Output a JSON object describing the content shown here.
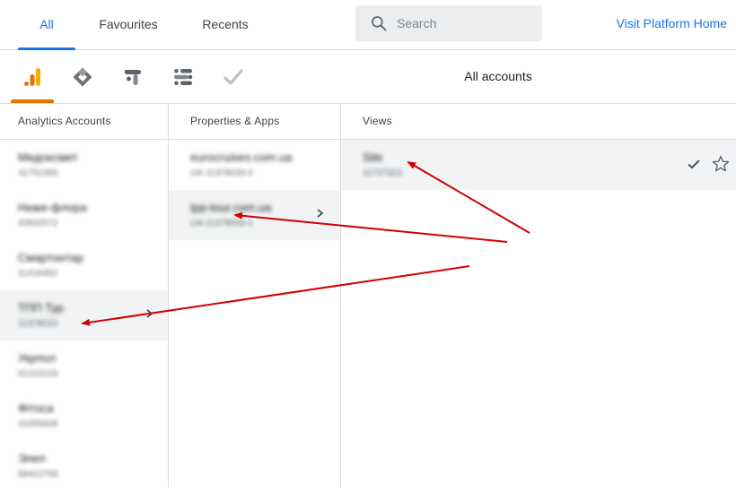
{
  "tabs": {
    "all": "All",
    "favourites": "Favourites",
    "recents": "Recents"
  },
  "search": {
    "placeholder": "Search"
  },
  "visit_link": "Visit Platform Home",
  "product_icons": [
    "analytics-icon",
    "tag-manager-icon",
    "optimize-icon",
    "data-studio-icon",
    "surveys-icon"
  ],
  "colors": {
    "accent": "#1a73e8",
    "analytics": "#e37400",
    "arrow": "#d00000"
  },
  "all_accounts_label": "All accounts",
  "columns": {
    "accounts": {
      "header": "Analytics Accounts",
      "items": [
        {
          "name": "Медоксмет",
          "id": "41752393"
        },
        {
          "name": "Ниже-флора",
          "id": "43932572"
        },
        {
          "name": "Смартонтар",
          "id": "11416492"
        },
        {
          "name": "TПП Тур",
          "id": "11378033"
        },
        {
          "name": "Укрпол",
          "id": "61222219"
        },
        {
          "name": "Фітоса",
          "id": "41055928"
        },
        {
          "name": "Элеп",
          "id": "68422759"
        }
      ]
    },
    "properties": {
      "header": "Properties & Apps",
      "items": [
        {
          "name": "eurocruises.com.ua",
          "id": "UA-11378033-2"
        },
        {
          "name": "tpp-tour.com.ua",
          "id": "UA-11378033-1"
        }
      ]
    },
    "views": {
      "header": "Views",
      "items": [
        {
          "name": "Site",
          "id": "11727323"
        }
      ]
    }
  }
}
